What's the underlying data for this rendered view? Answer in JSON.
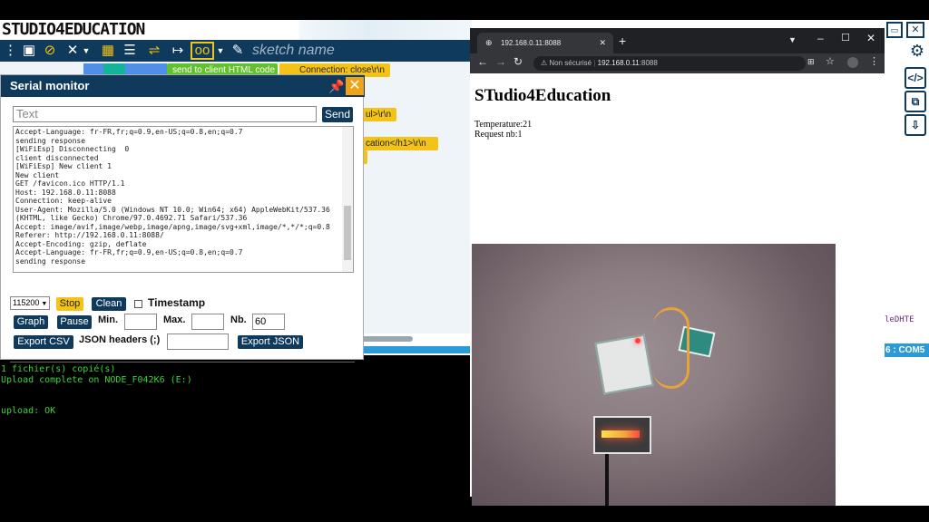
{
  "app": {
    "logo": "STUDIO4EDUCATION",
    "sketch_name_placeholder": "sketch name",
    "blocks": {
      "send_client_html": "send to client HTML code",
      "connection_close": "Connection: close\\r\\n",
      "ul_fragment": "ul>\\r\\n",
      "cation_fragment": "cation</h1>\\r\\n"
    },
    "side_label": "leDHTE",
    "port_label": "6 : COM5",
    "terminal_lines": [
      "1 fichier(s) copié(s)",
      "Upload complete on NODE_F042K6 (E:)",
      "",
      "",
      "upload: OK"
    ]
  },
  "serial": {
    "title": "Serial monitor",
    "text_placeholder": "Text",
    "send": "Send",
    "log_lines": [
      "Accept-Language: fr-FR,fr;q=0.9,en-US;q=0.8,en;q=0.7",
      "sending response",
      "[WiFiEsp] Disconnecting  0",
      "client disconnected",
      "[WiFiEsp] New client 1",
      "New client",
      "GET /favicon.ico HTTP/1.1",
      "Host: 192.168.0.11:8088",
      "Connection: keep-alive",
      "User-Agent: Mozilla/5.0 (Windows NT 10.0; Win64; x64) AppleWebKit/537.36",
      "(KHTML, like Gecko) Chrome/97.0.4692.71 Safari/537.36",
      "Accept: image/avif,image/webp,image/apng,image/svg+xml,image/*,*/*;q=0.8",
      "Referer: http://192.168.0.11:8088/",
      "Accept-Encoding: gzip, deflate",
      "Accept-Language: fr-FR,fr;q=0.9,en-US;q=0.8,en;q=0.7",
      "sending response"
    ],
    "baud": "115200",
    "stop": "Stop",
    "clean": "Clean",
    "timestamp": "Timestamp",
    "graph": "Graph",
    "pause": "Pause",
    "min_label": "Min.",
    "max_label": "Max.",
    "nb_label": "Nb.",
    "nb_value": "60",
    "export_csv": "Export CSV",
    "json_headers": "JSON headers (;)",
    "export_json": "Export JSON"
  },
  "browser": {
    "tab_title": "192.168.0.11:8088",
    "not_secure": "Non sécurisé",
    "url_host": "192.168.0.11",
    "url_port": ":8088",
    "page_heading": "STudio4Education",
    "temperature": "Temperature:21",
    "requests": "Request nb:1"
  }
}
